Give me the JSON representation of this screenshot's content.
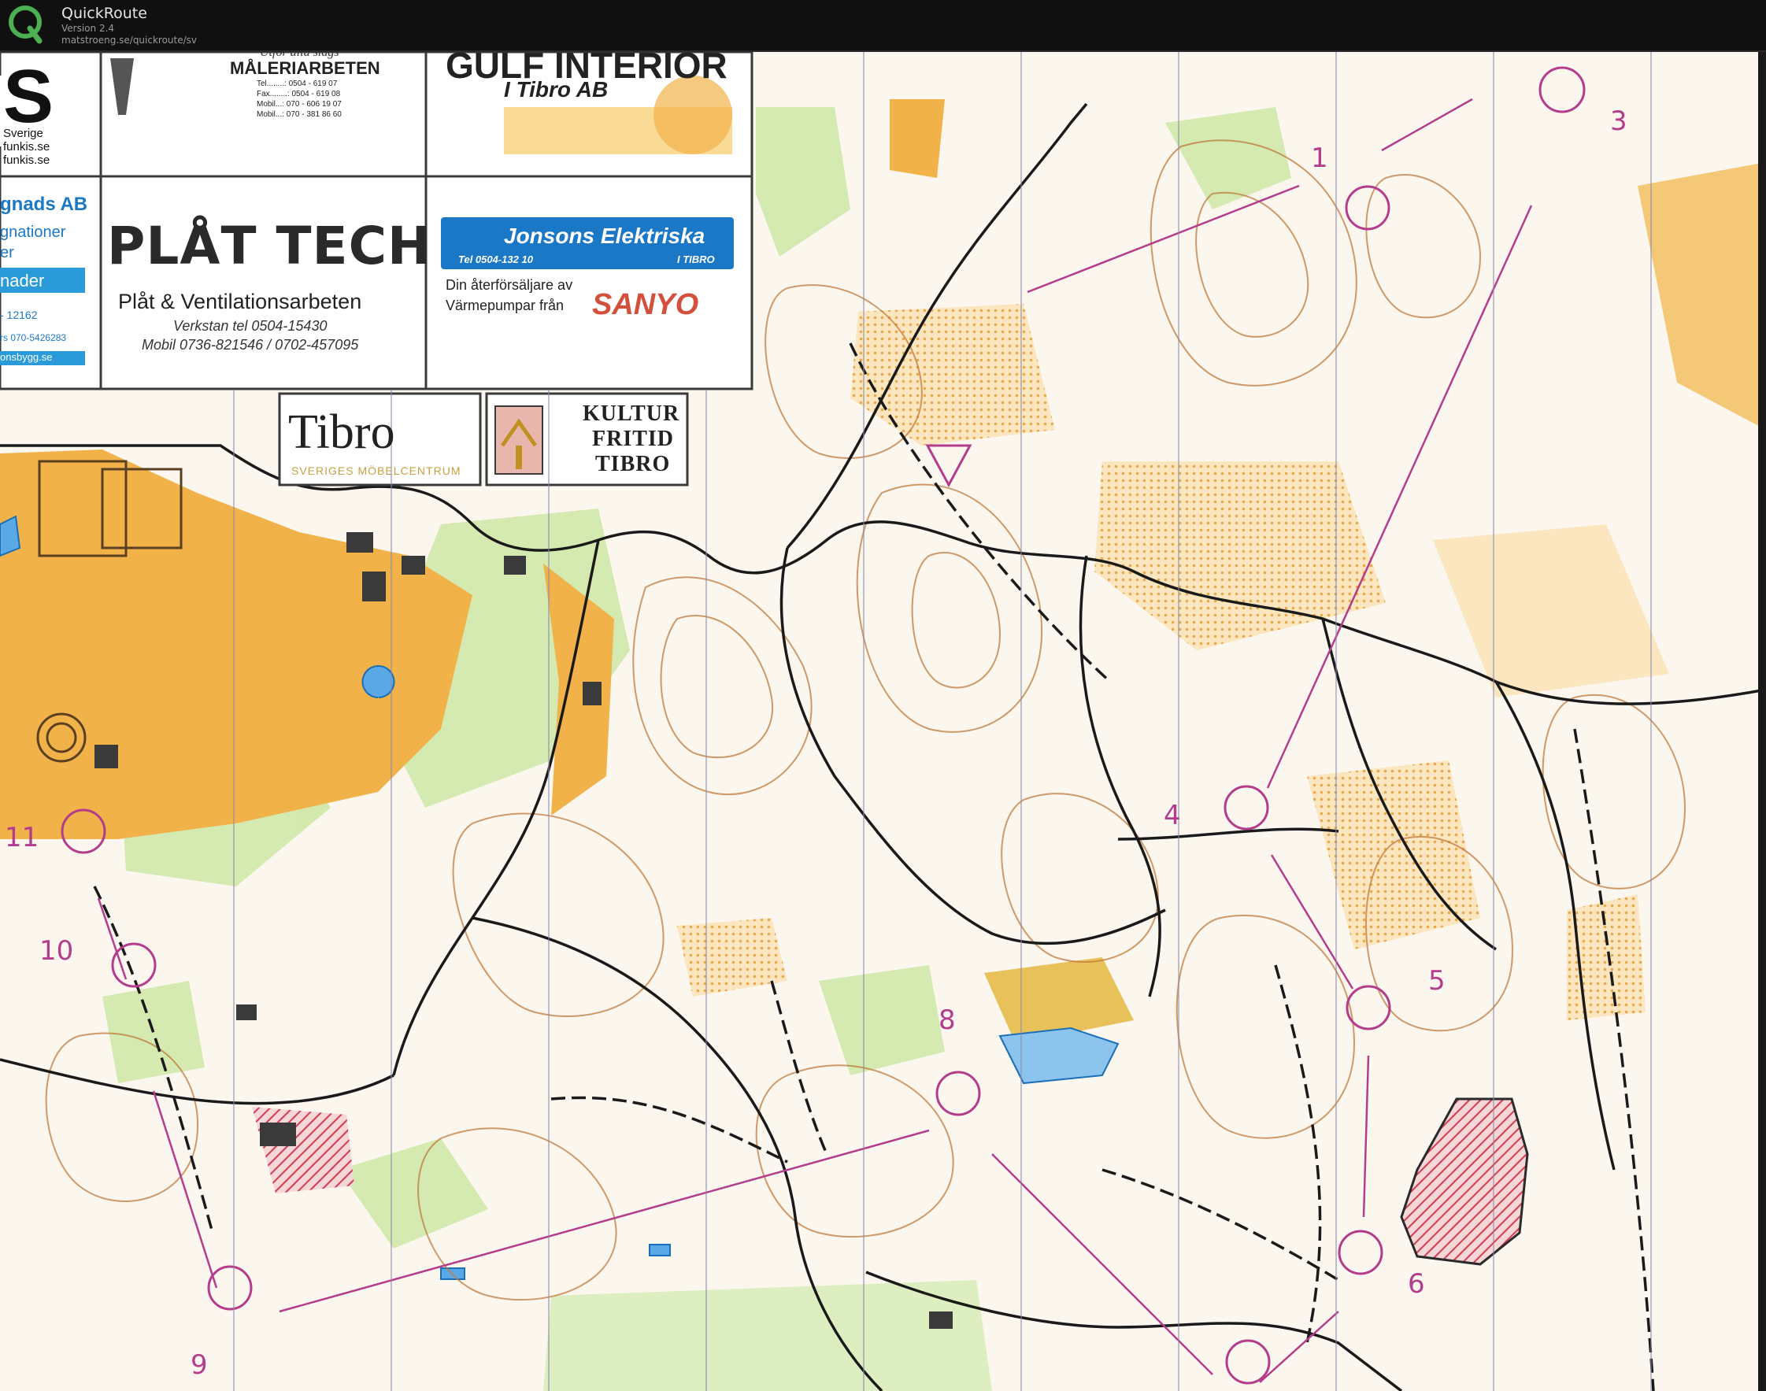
{
  "app": {
    "name": "QuickRoute",
    "version": "Version 2.4",
    "url": "matstroeng.se/quickroute/sv",
    "logo_letter": "Q",
    "logo_color": "#4caf50"
  },
  "map": {
    "course_color": "#b43c8c",
    "colors": {
      "open_land": "#f2b24a",
      "forest_green": "#c8e6a0",
      "contour": "#c07a3c",
      "water": "#1a7fd0",
      "private_area": "#d23c50"
    },
    "controls": [
      {
        "number": "1"
      },
      {
        "number": "3"
      },
      {
        "number": "4"
      },
      {
        "number": "5"
      },
      {
        "number": "6"
      },
      {
        "number": "8"
      },
      {
        "number": "9"
      },
      {
        "number": "10"
      },
      {
        "number": "11"
      }
    ],
    "start_symbol": "start-triangle"
  },
  "ads": {
    "frag_s": "S",
    "frag_sverige": "Sverige",
    "frag_funkis1": "funkis.se",
    "frag_funkis2": "funkis.se",
    "maleri": {
      "top": "Utför alla slags",
      "title": "MÅLERIARBETEN",
      "tel": "Tel........: 0504 - 619 07",
      "fax": "Fax........: 0504 - 619 08",
      "mobil1": "Mobil...: 070 - 606 19 07",
      "mobil2": "Mobil...: 070 - 381 86 60"
    },
    "gulf": {
      "line1": "GULF INTERIÖR",
      "line2": "I Tibro AB"
    },
    "bygg": {
      "name": "gnads AB",
      "line2": "gnationer",
      "line3": "er",
      "bar": "nader",
      "phone1": "- 12162",
      "phone2": "rs 070-5426283",
      "web": "onsbygg.se"
    },
    "plattech": {
      "logo": "PLÅT TECH",
      "subtitle": "Plåt & Ventilationsarbeten",
      "workshop": "Verkstan  tel  0504-15430",
      "mobile": "Mobil  0736-821546 / 0702-457095"
    },
    "jonsons": {
      "name": "Jonsons Elektriska",
      "tel": "Tel 0504-132 10",
      "city": "I TIBRO",
      "line1": "Din återförsäljare av",
      "line2": "Värmepumpar från",
      "brand": "SANYO"
    },
    "tibro": {
      "name": "Tibro",
      "tagline": "SVERIGES MÖBELCENTRUM"
    },
    "kultur": {
      "line1": "KULTUR",
      "line2": "FRITID",
      "line3": "TIBRO"
    }
  }
}
